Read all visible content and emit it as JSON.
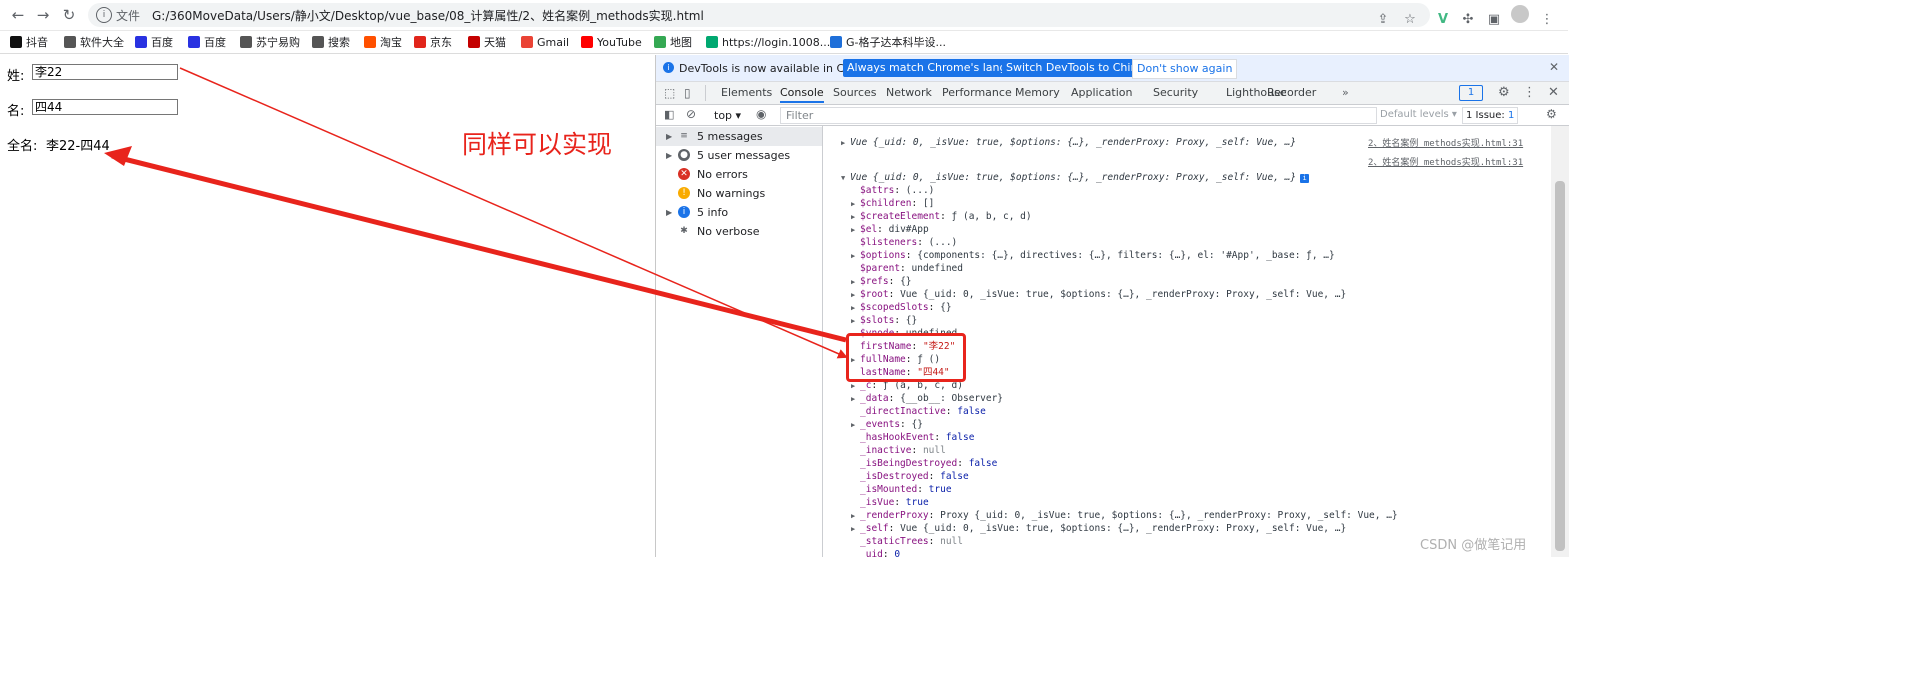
{
  "browser": {
    "url_scheme_label": "文件",
    "url": "G:/360MoveData/Users/静小文/Desktop/vue_base/08_计算属性/2、姓名案例_methods实现.html",
    "bookmarks": [
      {
        "label": "抖音",
        "icon": "douyin-icon",
        "color": "#111111"
      },
      {
        "label": "软件大全",
        "icon": "globe-icon",
        "color": "#555555"
      },
      {
        "label": "百度",
        "icon": "baidu-paw-icon",
        "color": "#2932e1"
      },
      {
        "label": "百度",
        "icon": "baidu-paw-icon",
        "color": "#2932e1"
      },
      {
        "label": "苏宁易购",
        "icon": "globe-icon",
        "color": "#555555"
      },
      {
        "label": "搜索",
        "icon": "globe-icon",
        "color": "#555555"
      },
      {
        "label": "淘宝",
        "icon": "taobao-icon",
        "color": "#ff5000"
      },
      {
        "label": "京东",
        "icon": "jd-icon",
        "color": "#e1251b"
      },
      {
        "label": "天猫",
        "icon": "tmall-icon",
        "color": "#c40000"
      },
      {
        "label": "Gmail",
        "icon": "gmail-icon",
        "color": "#ea4335"
      },
      {
        "label": "YouTube",
        "icon": "youtube-icon",
        "color": "#ff0000"
      },
      {
        "label": "地图",
        "icon": "maps-icon",
        "color": "#34a853"
      },
      {
        "label": "https://login.1008...",
        "icon": "globe-icon",
        "color": "#00a870"
      },
      {
        "label": "G-格子达本科毕设...",
        "icon": "globe-icon",
        "color": "#1e6fd9"
      }
    ]
  },
  "page": {
    "last_name_label": "姓:",
    "last_name_value": "李22",
    "first_name_label": "名:",
    "first_name_value": "四44",
    "full_name_label": "全名:",
    "full_name_value": "李22-四44",
    "annotation": "同样可以实现"
  },
  "devtools": {
    "banner_text": "DevTools is now available in Chinese!",
    "banner_btn1": "Always match Chrome's language",
    "banner_btn2": "Switch DevTools to Chinese",
    "banner_btn3": "Don't show again",
    "tabs": [
      "Elements",
      "Console",
      "Sources",
      "Network",
      "Performance",
      "Memory",
      "Application",
      "Security",
      "Lighthouse",
      "Recorder"
    ],
    "active_tab": "Console",
    "messages_badge": "1",
    "context": "top",
    "filter_placeholder": "Filter",
    "default_levels": "Default levels",
    "issues": "1 Issue:",
    "issues_count": "1",
    "sidebar": [
      {
        "label": "5 messages",
        "icon": "list-icon",
        "expandable": true
      },
      {
        "label": "5 user messages",
        "icon": "user-icon",
        "expandable": true
      },
      {
        "label": "No errors",
        "icon": "error-icon",
        "expandable": false
      },
      {
        "label": "No warnings",
        "icon": "warning-icon",
        "expandable": false
      },
      {
        "label": "5 info",
        "icon": "info-icon",
        "expandable": true
      },
      {
        "label": "No verbose",
        "icon": "bug-icon",
        "expandable": false
      }
    ],
    "console_lines": [
      {
        "text": "Vue {_uid: 0, _isVue: true, $options: {…}, _renderProxy: Proxy, _self: Vue, …}",
        "indent": 1,
        "arrow": "▶",
        "src": "2、姓名案例_methods实现.html:31"
      },
      {
        "text": "",
        "indent": 0,
        "arrow": "",
        "src": "2、姓名案例_methods实现.html:31"
      },
      {
        "text": "Vue {_uid: 0, _isVue: true, $options: {…}, _renderProxy: Proxy, _self: Vue, …}",
        "indent": 1,
        "arrow": "▼",
        "src": ""
      },
      {
        "key": "$attrs",
        "val": "(...)",
        "indent": 2,
        "arrow": ""
      },
      {
        "key": "$children",
        "val": "[]",
        "indent": 2,
        "arrow": "▶"
      },
      {
        "key": "$createElement",
        "val": "ƒ (a, b, c, d)",
        "indent": 2,
        "arrow": "▶"
      },
      {
        "key": "$el",
        "val": "div#App",
        "indent": 2,
        "arrow": "▶"
      },
      {
        "key": "$listeners",
        "val": "(...)",
        "indent": 2,
        "arrow": ""
      },
      {
        "key": "$options",
        "val": "{components: {…}, directives: {…}, filters: {…}, el: '#App', _base: ƒ, …}",
        "indent": 2,
        "arrow": "▶"
      },
      {
        "key": "$parent",
        "val": "undefined",
        "indent": 2,
        "arrow": ""
      },
      {
        "key": "$refs",
        "val": "{}",
        "indent": 2,
        "arrow": "▶"
      },
      {
        "key": "$root",
        "val": "Vue {_uid: 0, _isVue: true, $options: {…}, _renderProxy: Proxy, _self: Vue, …}",
        "indent": 2,
        "arrow": "▶"
      },
      {
        "key": "$scopedSlots",
        "val": "{}",
        "indent": 2,
        "arrow": "▶"
      },
      {
        "key": "$slots",
        "val": "{}",
        "indent": 2,
        "arrow": "▶"
      },
      {
        "key": "$vnode",
        "val": "undefined",
        "indent": 2,
        "arrow": ""
      },
      {
        "key": "firstName",
        "val": "\"李22\"",
        "indent": 2,
        "arrow": "",
        "type": "str"
      },
      {
        "key": "fullName",
        "val": "ƒ ()",
        "indent": 2,
        "arrow": "▶"
      },
      {
        "key": "lastName",
        "val": "\"四44\"",
        "indent": 2,
        "arrow": "",
        "type": "str"
      },
      {
        "key": "_c",
        "val": "ƒ (a, b, c, d)",
        "indent": 2,
        "arrow": "▶"
      },
      {
        "key": "_data",
        "val": "{__ob__: Observer}",
        "indent": 2,
        "arrow": "▶"
      },
      {
        "key": "_directInactive",
        "val": "false",
        "indent": 2,
        "arrow": "",
        "type": "kw"
      },
      {
        "key": "_events",
        "val": "{}",
        "indent": 2,
        "arrow": "▶"
      },
      {
        "key": "_hasHookEvent",
        "val": "false",
        "indent": 2,
        "arrow": "",
        "type": "kw"
      },
      {
        "key": "_inactive",
        "val": "null",
        "indent": 2,
        "arrow": "",
        "type": "gry"
      },
      {
        "key": "_isBeingDestroyed",
        "val": "false",
        "indent": 2,
        "arrow": "",
        "type": "kw"
      },
      {
        "key": "_isDestroyed",
        "val": "false",
        "indent": 2,
        "arrow": "",
        "type": "kw"
      },
      {
        "key": "_isMounted",
        "val": "true",
        "indent": 2,
        "arrow": "",
        "type": "kw"
      },
      {
        "key": "_isVue",
        "val": "true",
        "indent": 2,
        "arrow": "",
        "type": "kw"
      },
      {
        "key": "_renderProxy",
        "val": "Proxy {_uid: 0, _isVue: true, $options: {…}, _renderProxy: Proxy, _self: Vue, …}",
        "indent": 2,
        "arrow": "▶"
      },
      {
        "key": "_self",
        "val": "Vue {_uid: 0, _isVue: true, $options: {…}, _renderProxy: Proxy, _self: Vue, …}",
        "indent": 2,
        "arrow": "▶"
      },
      {
        "key": "_staticTrees",
        "val": "null",
        "indent": 2,
        "arrow": "",
        "type": "gry"
      },
      {
        "key": "_uid",
        "val": "0",
        "indent": 2,
        "arrow": "",
        "type": "kw"
      }
    ]
  },
  "watermark": "CSDN @做笔记用",
  "colors": {
    "accent": "#1a73e8",
    "annotation_red": "#e8241c"
  }
}
